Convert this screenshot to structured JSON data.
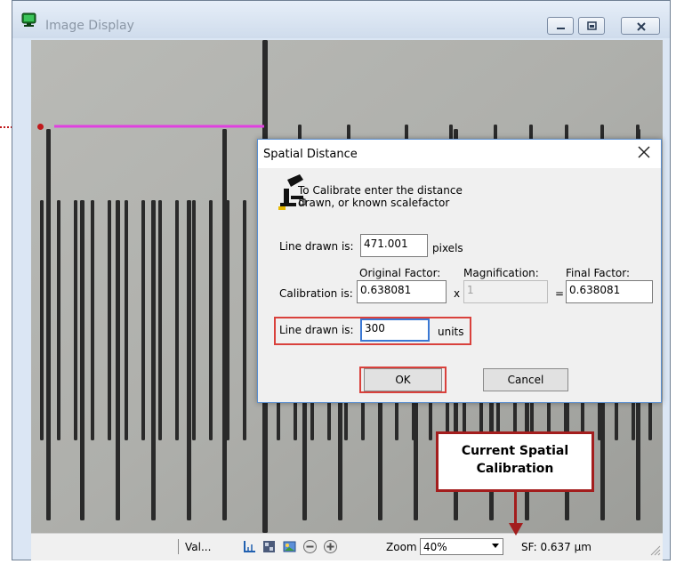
{
  "window": {
    "title": "Image Display"
  },
  "dialog": {
    "title": "Spatial Distance",
    "message_line1": "To Calibrate enter the distance",
    "message_line2": "drawn, or known scalefactor",
    "line_drawn_label": "Line drawn is:",
    "line_drawn_value": "471.001",
    "pixels_label": "pixels",
    "original_factor_label": "Original Factor:",
    "magnification_label": "Magnification:",
    "final_factor_label": "Final Factor:",
    "calibration_label": "Calibration is:",
    "original_factor_value": "0.638081",
    "multiply_sign": "x",
    "magnification_value": "1",
    "equals_sign": "=",
    "final_factor_value": "0.638081",
    "units_line_label": "Line drawn is:",
    "units_value": "300",
    "units_label": "units",
    "ok_label": "OK",
    "cancel_label": "Cancel"
  },
  "statusbar": {
    "val_label": "Val...",
    "zoom_label": "Zoom",
    "zoom_value": "40%",
    "sf_label": "SF: 0.637 µm"
  },
  "callout": {
    "line1": "Current Spatial",
    "line2": "Calibration"
  },
  "colors": {
    "annotation_red": "#a31d1d",
    "drawn_line_magenta": "#e040e0",
    "dialog_highlight": "#d9413c"
  }
}
